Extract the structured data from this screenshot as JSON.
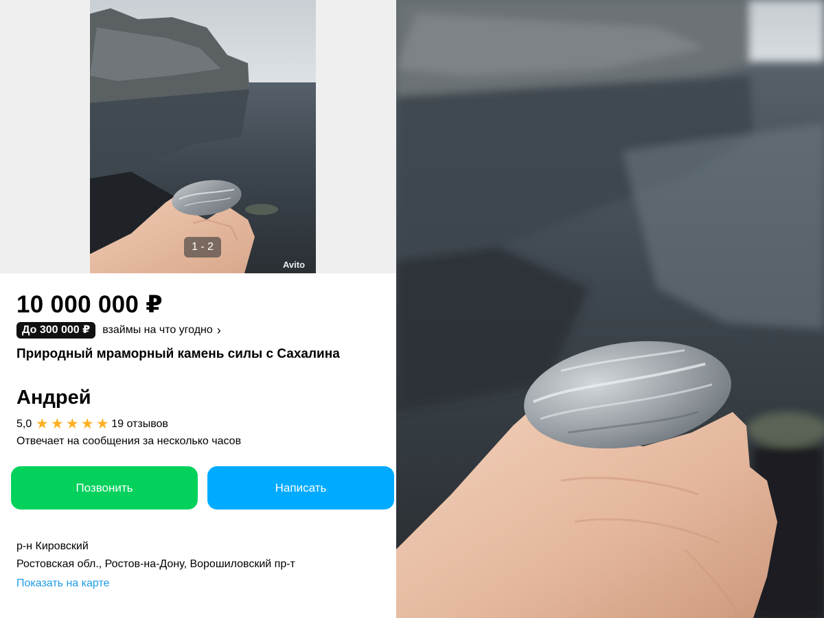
{
  "gallery": {
    "counter": "1 - 2",
    "watermark": "Avito"
  },
  "listing": {
    "price": "10 000 000 ₽",
    "loan_badge": "До 300 000 ₽",
    "loan_text": "взаймы на что угодно",
    "title": "Природный мраморный камень силы с Сахалина"
  },
  "seller": {
    "name": "Андрей",
    "rating": "5,0",
    "stars": 5,
    "reviews": "19 отзывов",
    "reply_info": "Отвечает на сообщения за несколько часов"
  },
  "buttons": {
    "call": "Позвонить",
    "message": "Написать"
  },
  "location": {
    "district": "р-н Кировский",
    "address": "Ростовская обл., Ростов-на-Дону, Ворошиловский пр-т",
    "map_link": "Показать на карте"
  },
  "colors": {
    "call_button": "#03d15c",
    "message_button": "#00aaff",
    "link": "#1e9be8",
    "star": "#ffb021"
  }
}
